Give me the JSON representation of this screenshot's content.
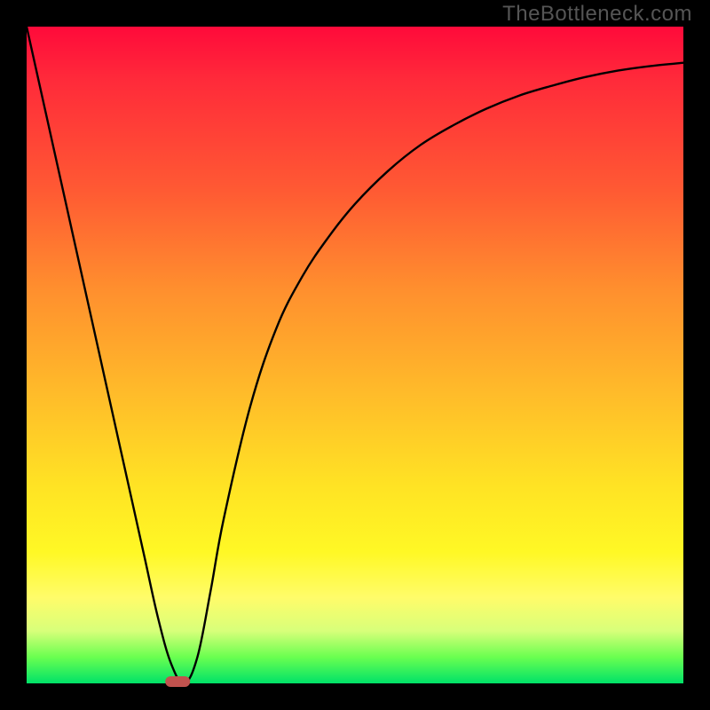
{
  "watermark": "TheBottleneck.com",
  "chart_data": {
    "type": "line",
    "title": "",
    "xlabel": "",
    "ylabel": "",
    "xlim": [
      0,
      100
    ],
    "ylim": [
      0,
      100
    ],
    "grid": false,
    "background_gradient": [
      "#ff0a3a",
      "#ff8f2e",
      "#ffe324",
      "#00e268"
    ],
    "series": [
      {
        "name": "bottleneck-curve",
        "x": [
          0,
          2,
          4,
          6,
          8,
          10,
          12,
          14,
          16,
          18,
          20,
          22,
          24,
          26,
          28,
          30,
          34,
          38,
          42,
          46,
          50,
          55,
          60,
          65,
          70,
          75,
          80,
          85,
          90,
          95,
          100
        ],
        "y": [
          100,
          91,
          82,
          73,
          64,
          55,
          46,
          37,
          28,
          19,
          10,
          3,
          0,
          4,
          14,
          25,
          42,
          54,
          62,
          68,
          73,
          78,
          82,
          85,
          87.5,
          89.5,
          91,
          92.3,
          93.3,
          94,
          94.5
        ]
      }
    ],
    "marker": {
      "x": 23,
      "y": 0,
      "color": "#c1524e",
      "shape": "pill"
    },
    "annotations": []
  }
}
